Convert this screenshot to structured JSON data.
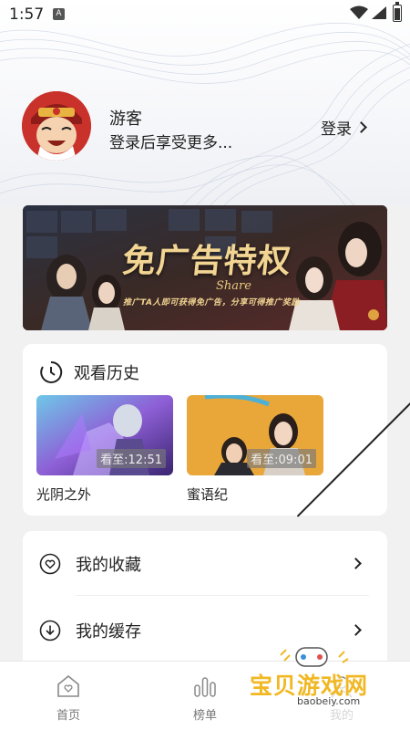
{
  "status_bar": {
    "time": "1:57",
    "notification_icon": "A"
  },
  "user": {
    "name": "游客",
    "subtitle": "登录后享受更多...",
    "login_label": "登录"
  },
  "banner": {
    "title": "免广告特权",
    "subtitle": "Share",
    "description": "推广TA人即可获得免广告，分享可得推广奖励"
  },
  "history": {
    "title": "观看历史",
    "items": [
      {
        "title": "光阴之外",
        "progress": "看至:12:51"
      },
      {
        "title": "蜜语纪",
        "progress": "看至:09:01"
      }
    ]
  },
  "menu": {
    "favorites": "我的收藏",
    "downloads": "我的缓存"
  },
  "tabbar": {
    "home": "首页",
    "ranking": "榜单",
    "mine": "我的"
  },
  "watermark": {
    "text": "宝贝游戏网",
    "url": "baobeiy.com"
  }
}
